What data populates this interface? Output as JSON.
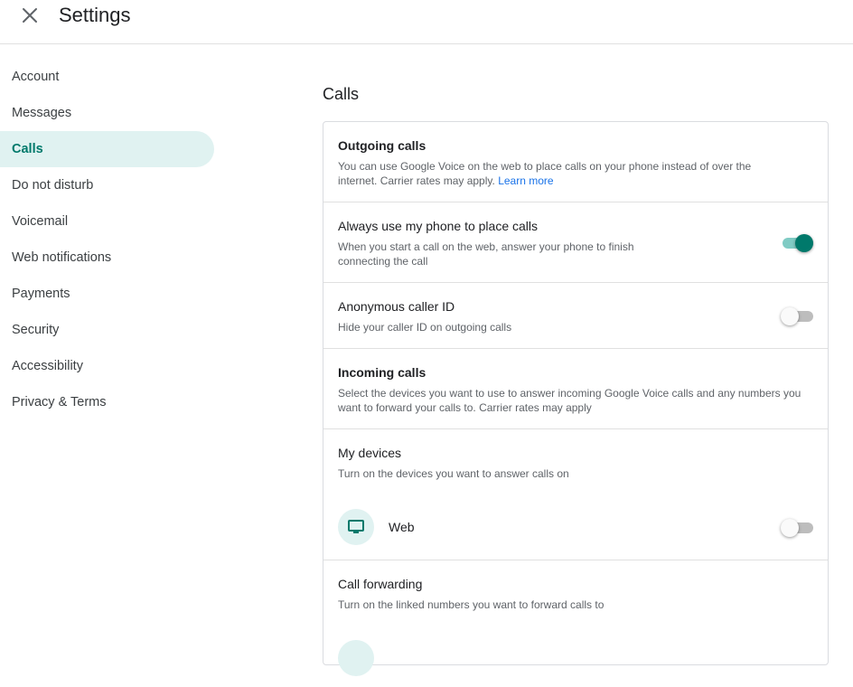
{
  "header": {
    "title": "Settings",
    "close_icon": "close-icon"
  },
  "sidebar": {
    "items": [
      {
        "label": "Account",
        "active": false
      },
      {
        "label": "Messages",
        "active": false
      },
      {
        "label": "Calls",
        "active": true
      },
      {
        "label": "Do not disturb",
        "active": false
      },
      {
        "label": "Voicemail",
        "active": false
      },
      {
        "label": "Web notifications",
        "active": false
      },
      {
        "label": "Payments",
        "active": false
      },
      {
        "label": "Security",
        "active": false
      },
      {
        "label": "Accessibility",
        "active": false
      },
      {
        "label": "Privacy & Terms",
        "active": false
      }
    ]
  },
  "main": {
    "section_title": "Calls",
    "outgoing": {
      "title": "Outgoing calls",
      "desc": "You can use Google Voice on the web to place calls on your phone instead of over the internet. Carrier rates may apply.",
      "link": "Learn more"
    },
    "always_phone": {
      "title": "Always use my phone to place calls",
      "desc_line1": "When you start a call on the web, answer your phone to finish",
      "desc_line2": "connecting the call",
      "enabled": true
    },
    "anon": {
      "title": "Anonymous caller ID",
      "desc": "Hide your caller ID on outgoing calls",
      "enabled": false
    },
    "incoming": {
      "title": "Incoming calls",
      "desc": "Select the devices you want to use to answer incoming Google Voice calls and any numbers you want to forward your calls to. Carrier rates may apply"
    },
    "devices": {
      "title": "My devices",
      "desc": "Turn on the devices you want to answer calls on",
      "web_label": "Web",
      "web_icon": "monitor-icon",
      "web_enabled": false
    },
    "forwarding": {
      "title": "Call forwarding",
      "desc": "Turn on the linked numbers you want to forward calls to"
    }
  },
  "colors": {
    "accent": "#00796b",
    "active_bg": "#e0f2f1",
    "link": "#1a73e8",
    "muted": "#5f6368"
  }
}
